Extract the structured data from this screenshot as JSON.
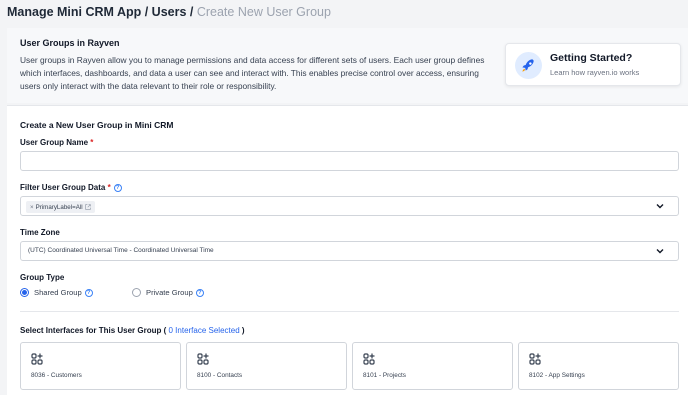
{
  "breadcrumb": {
    "part1": "Manage Mini CRM App / Users / ",
    "current": "Create New User Group"
  },
  "info": {
    "title": "User Groups in Rayven",
    "description": "User groups in Rayven allow you to manage permissions and data access for different sets of users. Each user group defines which interfaces, dashboards, and data a user can see and interact with. This enables precise control over access, ensuring users only interact with the data relevant to their role or responsibility."
  },
  "getting_started": {
    "title": "Getting Started?",
    "subtitle": "Learn how rayven.io works",
    "icon": "rocket-icon"
  },
  "form": {
    "section_title": "Create a New User Group in Mini CRM",
    "name_label": "User Group Name",
    "required_mark": "*",
    "name_value": "",
    "filter_label": "Filter User Group Data",
    "filter_tag": "PrimaryLabel=All",
    "filter_tag_remove": "×",
    "timezone_label": "Time Zone",
    "timezone_value": "(UTC) Coordinated Universal Time - Coordinated Universal Time",
    "group_type_label": "Group Type",
    "group_types": [
      {
        "label": "Shared Group",
        "selected": true
      },
      {
        "label": "Private Group",
        "selected": false
      }
    ],
    "interfaces_title_prefix": "Select Interfaces for This User Group (",
    "interfaces_count": "0 Interface Selected",
    "interfaces_title_suffix": ")",
    "interfaces": [
      {
        "label": "8036 - Customers"
      },
      {
        "label": "8100 - Contacts"
      },
      {
        "label": "8101 - Projects"
      },
      {
        "label": "8102 - App Settings"
      }
    ]
  },
  "colors": {
    "accent": "#2563eb",
    "required": "#dc2626",
    "muted": "#9ca3af"
  }
}
